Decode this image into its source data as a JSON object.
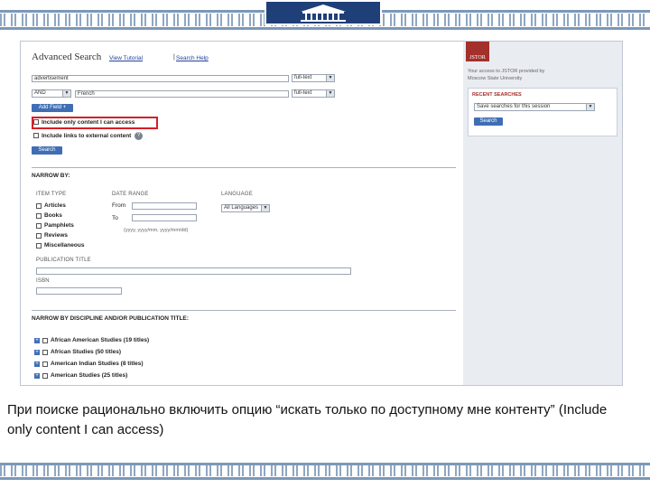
{
  "search": {
    "title": "Advanced Search",
    "link_tips": "View Tutorial",
    "link_help": "Search Help",
    "query_value": "advertisement",
    "field_select": "full-text",
    "operator_select": "AND",
    "second_query_value": "French",
    "second_field_select": "full-text",
    "add_field_label": "Add Field +",
    "option_access": "Include only content I can access",
    "option_external": "Include links to external content",
    "search_button": "Search"
  },
  "narrow": {
    "heading": "NARROW BY:",
    "item_type_title": "ITEM TYPE",
    "item_types": [
      "Articles",
      "Books",
      "Pamphlets",
      "Reviews",
      "Miscellaneous"
    ],
    "date_range_title": "DATE RANGE",
    "from_label": "From",
    "to_label": "To",
    "date_hint": "(yyyy, yyyy/mm, yyyy/mm/dd)",
    "language_title": "LANGUAGE",
    "language_select": "All Languages",
    "publication_title": "PUBLICATION TITLE",
    "isbn_title": "ISBN"
  },
  "discipline": {
    "heading": "NARROW BY DISCIPLINE AND/OR PUBLICATION TITLE:",
    "items": [
      "African American Studies (19 titles)",
      "African Studies (50 titles)",
      "American Indian Studies (8 titles)",
      "American Studies (25 titles)"
    ]
  },
  "sidebar": {
    "logo_text": "JSTOR",
    "access_text_1": "Your access to JSTOR provided by",
    "access_text_2": "Moscow State University",
    "recent_title": "RECENT SEARCHES",
    "recent_select": "Save searches for this session",
    "search_button": "Search"
  },
  "caption": "При поиске рационально включить опцию “искать только по доступному мне контенту” (Include only content I can access)"
}
